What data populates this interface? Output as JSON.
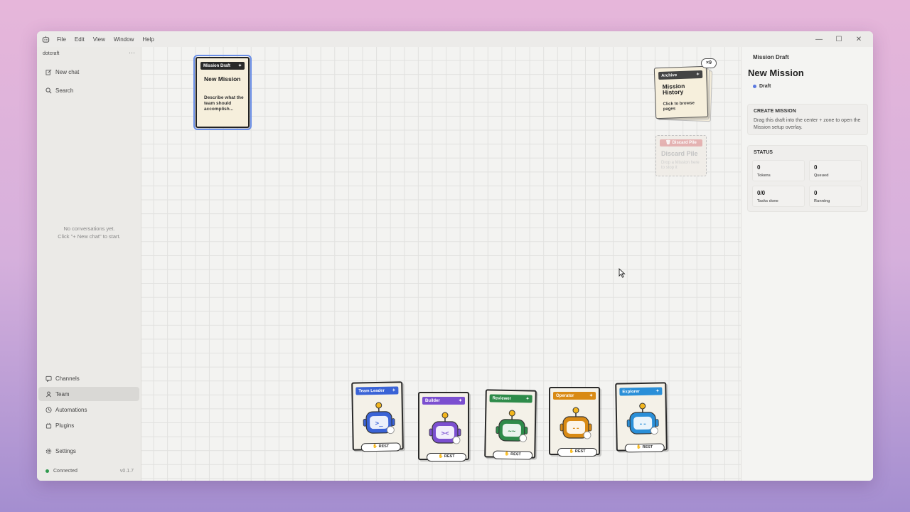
{
  "menu": {
    "items": [
      "File",
      "Edit",
      "View",
      "Window",
      "Help"
    ]
  },
  "window_controls": {
    "minimize": "—",
    "maximize": "☐",
    "close": "✕"
  },
  "sidebar": {
    "workspace": "dotcraft",
    "workspace_menu": "···",
    "new_chat": "New chat",
    "search": "Search",
    "empty_line1": "No conversations yet.",
    "empty_line2": "Click \"+ New chat\" to start.",
    "nav": {
      "channels": "Channels",
      "team": "Team",
      "automations": "Automations",
      "plugins": "Plugins",
      "settings": "Settings"
    },
    "connection": "Connected",
    "version": "v0.1.7"
  },
  "canvas": {
    "draft_card": {
      "tag": "Mission Draft",
      "title": "New Mission",
      "desc": "Describe what the team should accomplish..."
    },
    "archive": {
      "tag": "Archive",
      "title": "Mission History",
      "desc": "Click to browse pages",
      "count": "×9"
    },
    "discard": {
      "tag": "Discard Pile",
      "title": "Discard Pile",
      "desc": "Drop a Mission here to stop it"
    },
    "agents": [
      {
        "name": "Team Leader",
        "status": "REST",
        "color": "#3a63d6"
      },
      {
        "name": "Builder",
        "status": "REST",
        "color": "#7b4fd0"
      },
      {
        "name": "Reviewer",
        "status": "REST",
        "color": "#2e8b4a"
      },
      {
        "name": "Operator",
        "status": "REST",
        "color": "#d98a14"
      },
      {
        "name": "Explorer",
        "status": "REST",
        "color": "#2a8fd8"
      }
    ]
  },
  "panel": {
    "label": "Mission Draft",
    "title": "New Mission",
    "status": "Draft",
    "create_title": "CREATE MISSION",
    "create_text": "Drag this draft into the center + zone to open the Mission setup overlay.",
    "status_title": "STATUS",
    "stats": {
      "tokens_value": "0",
      "tokens_label": "Tokens",
      "queued_value": "0",
      "queued_label": "Queued",
      "tasks_value": "0/0",
      "tasks_label": "Tasks done",
      "running_value": "0",
      "running_label": "Running"
    }
  }
}
